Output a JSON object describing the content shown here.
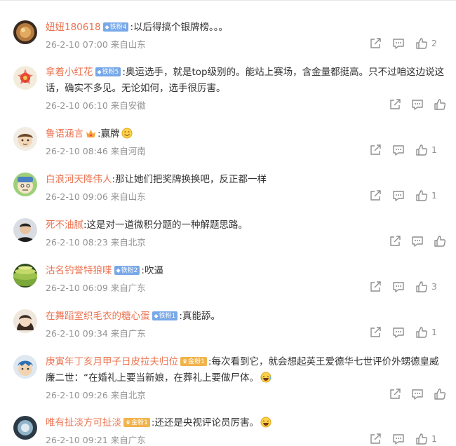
{
  "comments": [
    {
      "username": "妞妞180618",
      "badge": "铁粉4",
      "badge_type": "blue",
      "text": "以后得搞个银牌榜。。。",
      "time": "26-2-10 07:00",
      "location": "来自山东",
      "likes": "2"
    },
    {
      "username": "拿着小红花",
      "badge": "铁粉5",
      "badge_type": "blue",
      "text": "奥运选手，就是top级别的。能站上赛场，含金量都挺高。只不过咱这边说这话，确实不多见。无论如何，选手很厉害。",
      "time": "26-2-10 06:10",
      "location": "来自安徽",
      "likes": ""
    },
    {
      "username": "鲁语涵言",
      "badge": "",
      "badge_type": "crown",
      "text": "赢牌",
      "emoji": "smile-emoji",
      "time": "26-2-10 08:46",
      "location": "来自河南",
      "likes": "1"
    },
    {
      "username": "白浪河天降伟人",
      "badge": "",
      "badge_type": "",
      "text": "那让她们把奖牌换换吧，反正都一样",
      "time": "26-2-10 09:06",
      "location": "来自山东",
      "likes": "1"
    },
    {
      "username": "死不油腻",
      "badge": "",
      "badge_type": "",
      "text": "这是对一道微积分题的一种解题思路。",
      "time": "26-2-10 08:23",
      "location": "来自北京",
      "likes": ""
    },
    {
      "username": "沽名钓誉特狼喋",
      "badge": "铁粉2",
      "badge_type": "blue",
      "text": "吹逼",
      "time": "26-2-10 06:09",
      "location": "来自广东",
      "likes": "3"
    },
    {
      "username": "在舞蹈室织毛衣的糖心蛋",
      "badge": "铁粉1",
      "badge_type": "blue",
      "text": "真能舔。",
      "time": "26-2-10 09:34",
      "location": "来自广东",
      "likes": "1"
    },
    {
      "username": "庚寅年丁亥月甲子日皮拉夫归位",
      "badge": "金粉1",
      "badge_type": "gold",
      "text": "每次看到它，就会想起英王爱德华七世评价外甥德皇威廉二世：“在婚礼上要当新娘，在葬礼上要做尸体。",
      "emoji": "laugh-cry-emoji",
      "time": "26-2-10 09:26",
      "location": "来自北京",
      "likes": ""
    },
    {
      "username": "唯有扯淡方可扯淡",
      "badge": "金粉1",
      "badge_type": "gold",
      "text": "还还是央视评论员厉害。",
      "emoji": "laugh-emoji",
      "time": "26-2-10 09:21",
      "location": "来自广东",
      "likes": "1"
    }
  ],
  "colors": {
    "username": "#eb7350",
    "text": "#333333",
    "meta": "#939393",
    "fan_badge": "#77a8e8",
    "gold_badge": "#f1b34b"
  }
}
